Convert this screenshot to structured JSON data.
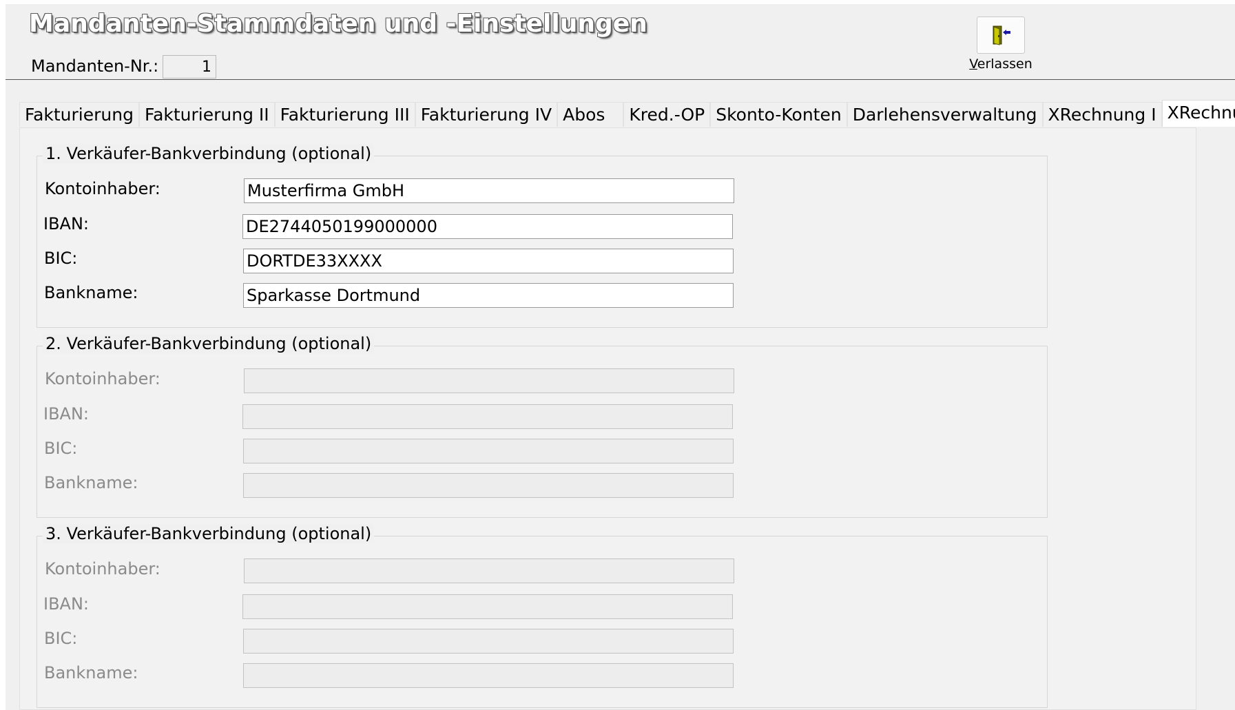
{
  "header": {
    "title": "Mandanten-Stammdaten und -Einstellungen",
    "mandant_label": "Mandanten-Nr.:",
    "mandant_value": "1",
    "exit_label_underlined": "V",
    "exit_label_rest": "erlassen",
    "exit_icon": "door-exit-icon"
  },
  "tabs": [
    {
      "label": "Fakturierung"
    },
    {
      "label": "Fakturierung II"
    },
    {
      "label": "Fakturierung III"
    },
    {
      "label": "Fakturierung IV"
    },
    {
      "label": "Abos"
    },
    {
      "label": "Kred.-OP"
    },
    {
      "label": "Skonto-Konten"
    },
    {
      "label": "Darlehensverwaltung"
    },
    {
      "label": "XRechnung I"
    },
    {
      "label": "XRechnung II"
    }
  ],
  "active_tab": "XRechnung II",
  "groups": [
    {
      "title": "1. Verkäufer-Bankverbindung (optional)",
      "enabled": true,
      "fields": [
        {
          "label": "Kontoinhaber:",
          "value": "Musterfirma GmbH"
        },
        {
          "label": "IBAN:",
          "value": "DE2744050199000000"
        },
        {
          "label": "BIC:",
          "value": "DORTDE33XXXX"
        },
        {
          "label": "Bankname:",
          "value": "Sparkasse Dortmund"
        }
      ]
    },
    {
      "title": "2. Verkäufer-Bankverbindung (optional)",
      "enabled": false,
      "fields": [
        {
          "label": "Kontoinhaber:",
          "value": ""
        },
        {
          "label": "IBAN:",
          "value": ""
        },
        {
          "label": "BIC:",
          "value": ""
        },
        {
          "label": "Bankname:",
          "value": ""
        }
      ]
    },
    {
      "title": "3. Verkäufer-Bankverbindung (optional)",
      "enabled": false,
      "fields": [
        {
          "label": "Kontoinhaber:",
          "value": ""
        },
        {
          "label": "IBAN:",
          "value": ""
        },
        {
          "label": "BIC:",
          "value": ""
        },
        {
          "label": "Bankname:",
          "value": ""
        }
      ]
    }
  ]
}
